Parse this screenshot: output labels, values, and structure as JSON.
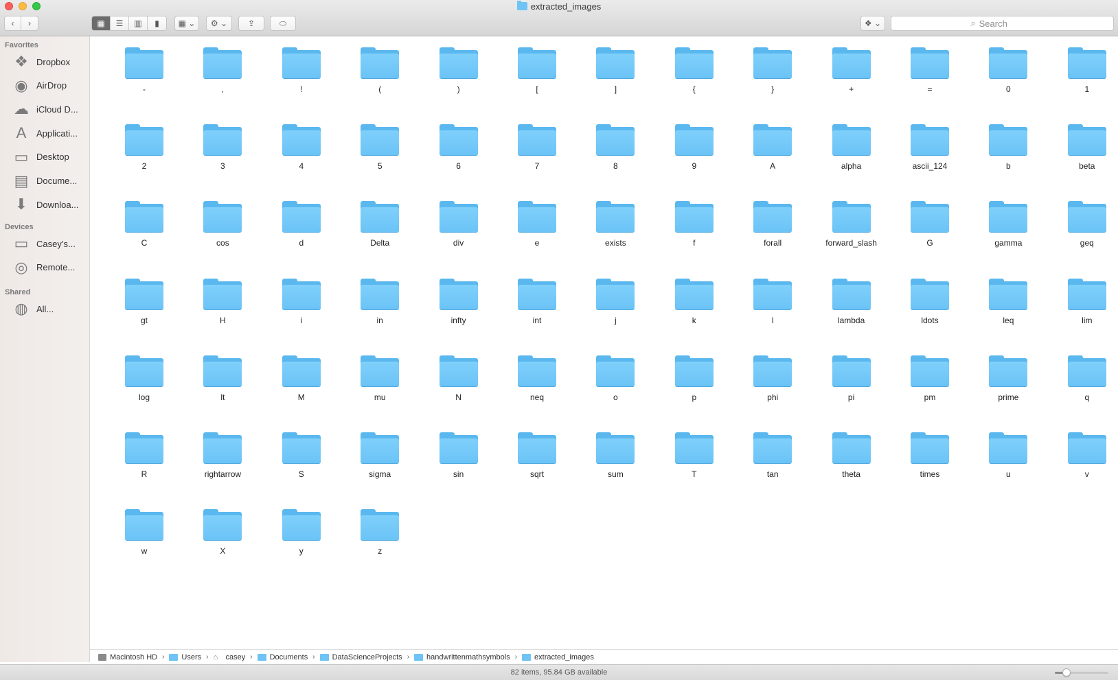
{
  "window": {
    "title": "extracted_images"
  },
  "toolbar": {
    "back_icon": "chevron-left-icon",
    "forward_icon": "chevron-right-icon",
    "view_icons": [
      "icon-view",
      "list-view",
      "column-view",
      "cover-flow-view"
    ],
    "active_view": "icon-view",
    "search_placeholder": "Search"
  },
  "sidebar": {
    "sections": [
      {
        "title": "Favorites",
        "items": [
          {
            "label": "Dropbox",
            "icon": "dropbox-icon",
            "glyph": "❖"
          },
          {
            "label": "AirDrop",
            "icon": "airdrop-icon",
            "glyph": "◉"
          },
          {
            "label": "iCloud D...",
            "icon": "cloud-icon",
            "glyph": "☁"
          },
          {
            "label": "Applicati...",
            "icon": "applications-icon",
            "glyph": "A"
          },
          {
            "label": "Desktop",
            "icon": "desktop-icon",
            "glyph": "▭"
          },
          {
            "label": "Docume...",
            "icon": "documents-icon",
            "glyph": "▤"
          },
          {
            "label": "Downloa...",
            "icon": "downloads-icon",
            "glyph": "⬇"
          }
        ]
      },
      {
        "title": "Devices",
        "items": [
          {
            "label": "Casey’s...",
            "icon": "laptop-icon",
            "glyph": "▭"
          },
          {
            "label": "Remote...",
            "icon": "disc-icon",
            "glyph": "◎"
          }
        ]
      },
      {
        "title": "Shared",
        "items": [
          {
            "label": "All...",
            "icon": "network-icon",
            "glyph": "◍"
          }
        ]
      }
    ]
  },
  "folders": [
    "-",
    ",",
    "!",
    "(",
    ")",
    "[",
    "]",
    "{",
    "}",
    "+",
    "=",
    "0",
    "1",
    "2",
    "3",
    "4",
    "5",
    "6",
    "7",
    "8",
    "9",
    "A",
    "alpha",
    "ascii_124",
    "b",
    "beta",
    "C",
    "cos",
    "d",
    "Delta",
    "div",
    "e",
    "exists",
    "f",
    "forall",
    "forward_slash",
    "G",
    "gamma",
    "geq",
    "gt",
    "H",
    "i",
    "in",
    "infty",
    "int",
    "j",
    "k",
    "l",
    "lambda",
    "ldots",
    "leq",
    "lim",
    "log",
    "lt",
    "M",
    "mu",
    "N",
    "neq",
    "o",
    "p",
    "phi",
    "pi",
    "pm",
    "prime",
    "q",
    "R",
    "rightarrow",
    "S",
    "sigma",
    "sin",
    "sqrt",
    "sum",
    "T",
    "tan",
    "theta",
    "times",
    "u",
    "v",
    "w",
    "X",
    "y",
    "z"
  ],
  "pathbar": {
    "crumbs": [
      {
        "label": "Macintosh HD",
        "icon": "hard-drive-icon"
      },
      {
        "label": "Users",
        "icon": "folder-icon"
      },
      {
        "label": "casey",
        "icon": "home-icon"
      },
      {
        "label": "Documents",
        "icon": "folder-icon"
      },
      {
        "label": "DataScienceProjects",
        "icon": "folder-icon"
      },
      {
        "label": "handwrittenmathsymbols",
        "icon": "folder-icon"
      },
      {
        "label": "extracted_images",
        "icon": "folder-icon"
      }
    ]
  },
  "statusbar": {
    "text": "82 items, 95.84 GB available",
    "icon_size_level": 0.22
  },
  "colors": {
    "folder": "#6bc3f6",
    "close": "#fc605c",
    "minimize": "#fdbc40",
    "maximize": "#34c84a"
  }
}
